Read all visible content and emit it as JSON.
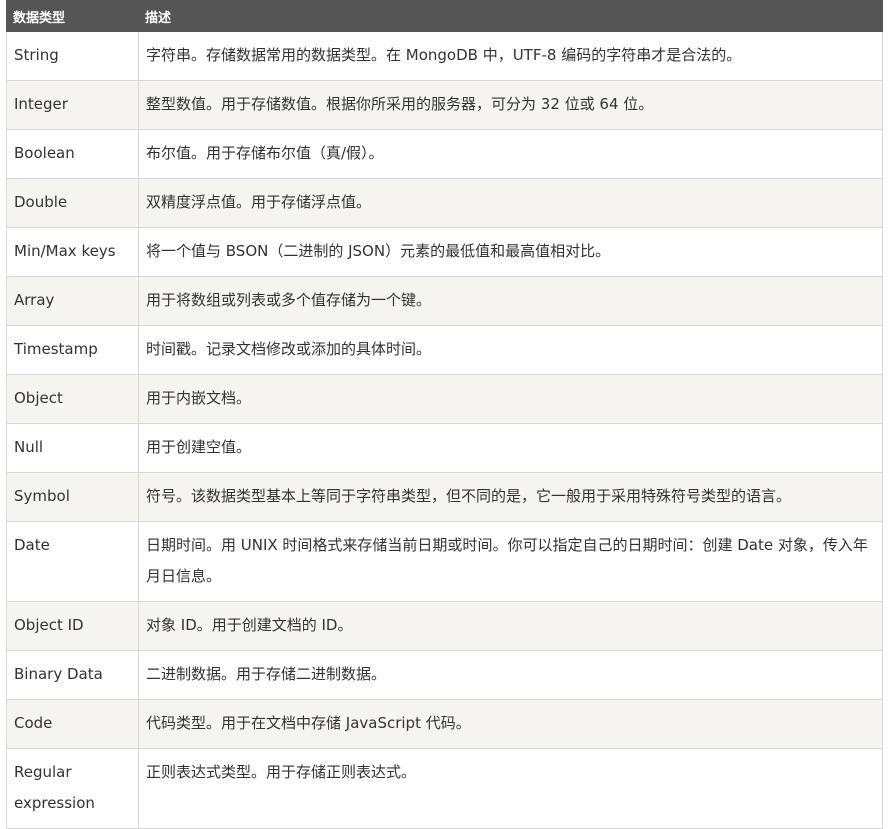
{
  "table": {
    "headers": [
      "数据类型",
      "描述"
    ],
    "rows": [
      {
        "type": "String",
        "desc": "字符串。存储数据常用的数据类型。在 MongoDB 中，UTF-8 编码的字符串才是合法的。"
      },
      {
        "type": "Integer",
        "desc": "整型数值。用于存储数值。根据你所采用的服务器，可分为 32 位或 64 位。"
      },
      {
        "type": "Boolean",
        "desc": "布尔值。用于存储布尔值（真/假）。"
      },
      {
        "type": "Double",
        "desc": "双精度浮点值。用于存储浮点值。"
      },
      {
        "type": "Min/Max keys",
        "desc": "将一个值与 BSON（二进制的 JSON）元素的最低值和最高值相对比。"
      },
      {
        "type": "Array",
        "desc": "用于将数组或列表或多个值存储为一个键。"
      },
      {
        "type": "Timestamp",
        "desc": "时间戳。记录文档修改或添加的具体时间。"
      },
      {
        "type": "Object",
        "desc": "用于内嵌文档。"
      },
      {
        "type": "Null",
        "desc": "用于创建空值。"
      },
      {
        "type": "Symbol",
        "desc": "符号。该数据类型基本上等同于字符串类型，但不同的是，它一般用于采用特殊符号类型的语言。"
      },
      {
        "type": "Date",
        "desc": "日期时间。用 UNIX 时间格式来存储当前日期或时间。你可以指定自己的日期时间：创建 Date 对象，传入年月日信息。"
      },
      {
        "type": "Object ID",
        "desc": "对象 ID。用于创建文档的 ID。"
      },
      {
        "type": "Binary Data",
        "desc": "二进制数据。用于存储二进制数据。"
      },
      {
        "type": "Code",
        "desc": "代码类型。用于在文档中存储 JavaScript 代码。"
      },
      {
        "type": "Regular expression",
        "desc": "正则表达式类型。用于存储正则表达式。"
      }
    ]
  }
}
